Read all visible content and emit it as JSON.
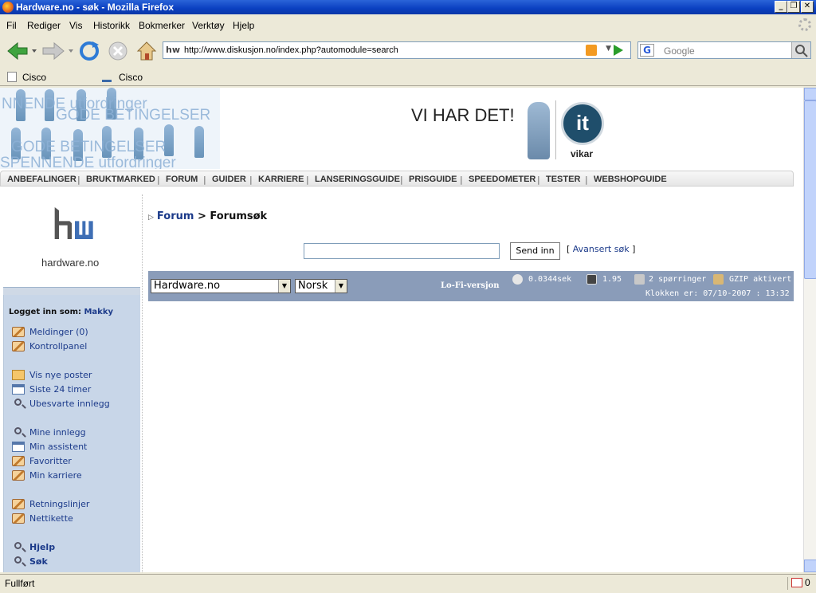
{
  "window": {
    "title": "Hardware.no - søk - Mozilla Firefox"
  },
  "menu": [
    "Fil",
    "Rediger",
    "Vis",
    "Historikk",
    "Bokmerker",
    "Verktøy",
    "Hjelp"
  ],
  "urlbar": {
    "url": "http://www.diskusjon.no/index.php?automodule=search",
    "favicon": "hw"
  },
  "search": {
    "engine": "G",
    "placeholder": "Google"
  },
  "bookmarks": [
    "Cisco",
    "Cisco"
  ],
  "banner": {
    "left_text_lines": [
      "NNENDE utfordringer",
      "GODE BETINGELSER",
      "GODE BETINGELSER",
      "SPENNENDE utfordringer"
    ],
    "slogan": "VI HAR DET!",
    "logo_letters": "it",
    "logo_caption": "vikar"
  },
  "topnav": [
    "ANBEFALINGER",
    "BRUKTMARKED",
    "FORUM",
    "GUIDER",
    "KARRIERE",
    "LANSERINGSGUIDE",
    "PRISGUIDE",
    "SPEEDOMETER",
    "TESTER",
    "WEBSHOPGUIDE"
  ],
  "logo": {
    "text": "hardware.no"
  },
  "sidebar": {
    "logged_in_label": "Logget inn som:",
    "username": "Makky",
    "items": [
      {
        "label": "Meldinger (0)",
        "icon": "pencil-icon"
      },
      {
        "label": "Kontrollpanel",
        "icon": "pencil-icon"
      },
      {
        "label": "Vis nye poster",
        "icon": "mail-icon"
      },
      {
        "label": "Siste 24 timer",
        "icon": "calendar-icon"
      },
      {
        "label": "Ubesvarte innlegg",
        "icon": "magnifier-icon"
      },
      {
        "label": "Mine innlegg",
        "icon": "magnifier-icon"
      },
      {
        "label": "Min assistent",
        "icon": "calendar-icon"
      },
      {
        "label": "Favoritter",
        "icon": "pencil-icon"
      },
      {
        "label": "Min karriere",
        "icon": "pencil-icon"
      },
      {
        "label": "Retningslinjer",
        "icon": "pencil-icon"
      },
      {
        "label": "Nettikette",
        "icon": "pencil-icon"
      },
      {
        "label": "Hjelp",
        "icon": "magnifier-icon"
      },
      {
        "label": "Søk",
        "icon": "magnifier-icon"
      }
    ]
  },
  "main": {
    "breadcrumb_link": "Forum",
    "breadcrumb_sep": ">",
    "breadcrumb_current": "Forumsøk",
    "search_value": "",
    "send_button": "Send inn",
    "advanced_link": "Avansert søk",
    "bracket_open": "[",
    "bracket_close": "]"
  },
  "footer": {
    "skin_select": "Hardware.no",
    "lang_select": "Norsk",
    "lofi": "Lo-Fi-versjon",
    "exec_time": "0.0344sek",
    "load": "1.95",
    "queries": "2 spørringer",
    "gzip": "GZIP aktivert",
    "clock": "Klokken er: 07/10-2007 : 13:32"
  },
  "status": {
    "text": "Fullført",
    "mail_count": "0"
  }
}
